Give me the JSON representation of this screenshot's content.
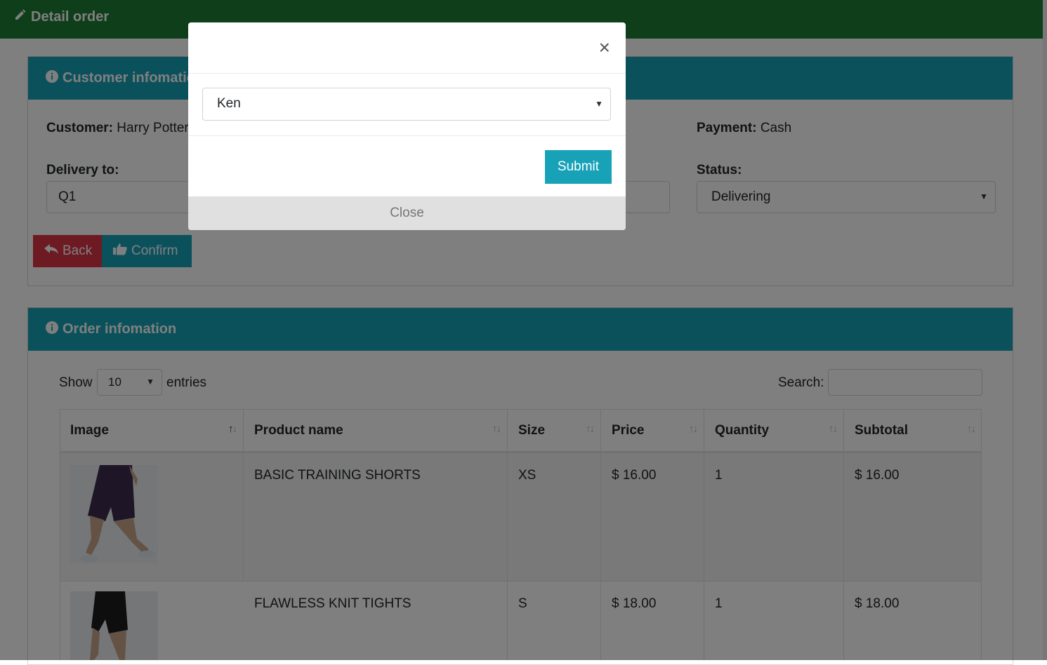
{
  "header": {
    "title": "Detail order",
    "icon": "pencil-icon"
  },
  "customer_card": {
    "title": "Customer infomation",
    "customer_label": "Customer:",
    "customer_value": "Harry Potter",
    "payment_label": "Payment:",
    "payment_value": "Cash",
    "delivery_label": "Delivery to:",
    "delivery_value": "Q1",
    "status_label": "Status:",
    "status_value": "Delivering",
    "back_label": "Back",
    "confirm_label": "Confirm"
  },
  "order_card": {
    "title": "Order infomation",
    "show_label": "Show",
    "entries_value": "10",
    "entries_label": "entries",
    "search_label": "Search:",
    "search_value": "",
    "columns": [
      "Image",
      "Product name",
      "Size",
      "Price",
      "Quantity",
      "Subtotal"
    ],
    "rows": [
      {
        "product": "BASIC TRAINING SHORTS",
        "size": "XS",
        "price": "$ 16.00",
        "quantity": "1",
        "subtotal": "$ 16.00"
      },
      {
        "product": "FLAWLESS KNIT TIGHTS",
        "size": "S",
        "price": "$ 18.00",
        "quantity": "1",
        "subtotal": "$ 18.00"
      }
    ]
  },
  "modal": {
    "selected": "Ken",
    "submit_label": "Submit",
    "close_label": "Close",
    "close_icon": "×"
  },
  "colors": {
    "header_green": "#1e7e34",
    "card_header_teal": "#17a2b8",
    "back_red": "#dc3545"
  }
}
